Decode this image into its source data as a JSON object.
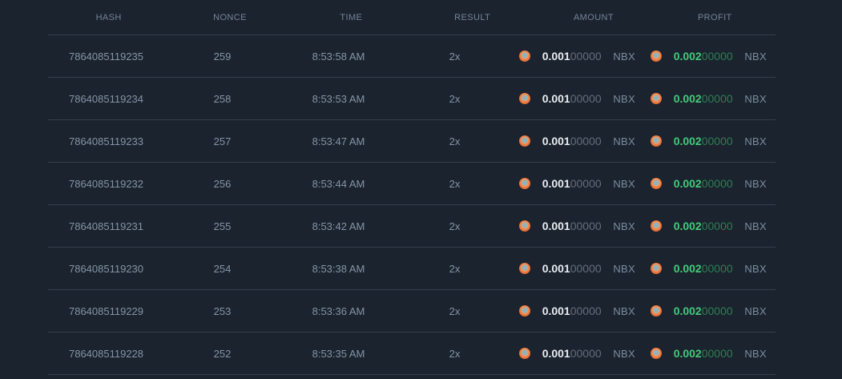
{
  "table": {
    "columns": [
      {
        "id": "hash",
        "label": "HASH"
      },
      {
        "id": "nonce",
        "label": "NONCE"
      },
      {
        "id": "time",
        "label": "TIME"
      },
      {
        "id": "result",
        "label": "RESULT"
      },
      {
        "id": "amount",
        "label": "AMOUNT"
      },
      {
        "id": "profit",
        "label": "PROFIT"
      }
    ],
    "currency_unit": "NBX",
    "rows": [
      {
        "hash": "7864085119235",
        "nonce": "259",
        "time": "8:53:58 AM",
        "result": "2x",
        "amount_main": "0.001",
        "amount_zeros": "00000",
        "profit_main": "0.002",
        "profit_zeros": "00000"
      },
      {
        "hash": "7864085119234",
        "nonce": "258",
        "time": "8:53:53 AM",
        "result": "2x",
        "amount_main": "0.001",
        "amount_zeros": "00000",
        "profit_main": "0.002",
        "profit_zeros": "00000"
      },
      {
        "hash": "7864085119233",
        "nonce": "257",
        "time": "8:53:47 AM",
        "result": "2x",
        "amount_main": "0.001",
        "amount_zeros": "00000",
        "profit_main": "0.002",
        "profit_zeros": "00000"
      },
      {
        "hash": "7864085119232",
        "nonce": "256",
        "time": "8:53:44 AM",
        "result": "2x",
        "amount_main": "0.001",
        "amount_zeros": "00000",
        "profit_main": "0.002",
        "profit_zeros": "00000"
      },
      {
        "hash": "7864085119231",
        "nonce": "255",
        "time": "8:53:42 AM",
        "result": "2x",
        "amount_main": "0.001",
        "amount_zeros": "00000",
        "profit_main": "0.002",
        "profit_zeros": "00000"
      },
      {
        "hash": "7864085119230",
        "nonce": "254",
        "time": "8:53:38 AM",
        "result": "2x",
        "amount_main": "0.001",
        "amount_zeros": "00000",
        "profit_main": "0.002",
        "profit_zeros": "00000"
      },
      {
        "hash": "7864085119229",
        "nonce": "253",
        "time": "8:53:36 AM",
        "result": "2x",
        "amount_main": "0.001",
        "amount_zeros": "00000",
        "profit_main": "0.002",
        "profit_zeros": "00000"
      },
      {
        "hash": "7864085119228",
        "nonce": "252",
        "time": "8:53:35 AM",
        "result": "2x",
        "amount_main": "0.001",
        "amount_zeros": "00000",
        "profit_main": "0.002",
        "profit_zeros": "00000"
      }
    ]
  },
  "icons": {
    "coin": "coin-icon"
  },
  "colors": {
    "background": "#1b232e",
    "row_divider": "#343f4b",
    "header_text": "#75849b",
    "row_text": "#8494a6",
    "amount_main": "#e8edf2",
    "amount_zeros": "#626e7d",
    "profit_main": "#43cb79",
    "profit_zeros": "#2e7e54",
    "unit_text": "#7b8ca0",
    "coin_orange": "#e9743b",
    "coin_center": "#8fb3bd"
  }
}
